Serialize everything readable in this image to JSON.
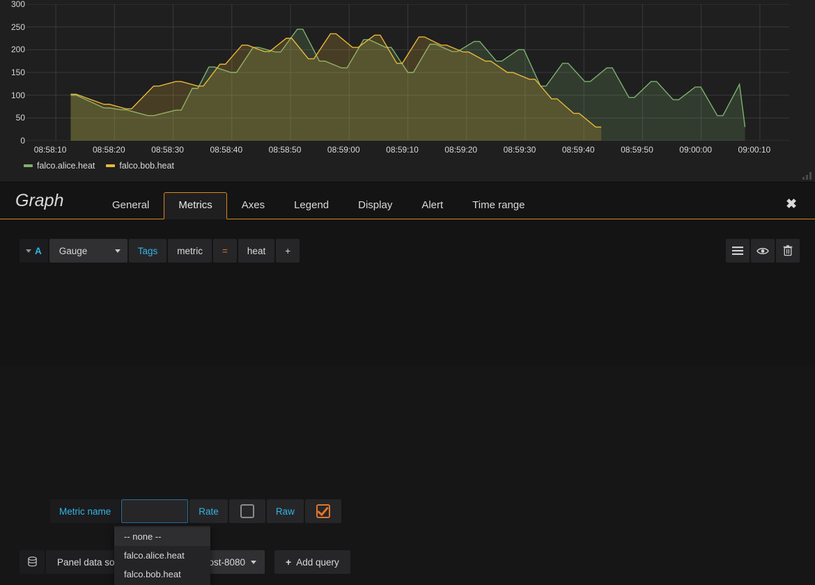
{
  "graph": {
    "legend": [
      {
        "label": "falco.alice.heat",
        "color": "#7eb26d"
      },
      {
        "label": "falco.bob.heat",
        "color": "#eab839"
      }
    ]
  },
  "chart_data": {
    "type": "line",
    "title": "",
    "xlabel": "",
    "ylabel": "",
    "ylim": [
      0,
      300
    ],
    "y_ticks": [
      0,
      50,
      100,
      150,
      200,
      250,
      300
    ],
    "x_ticks": [
      "08:58:10",
      "08:58:20",
      "08:58:30",
      "08:58:40",
      "08:58:50",
      "08:59:00",
      "08:59:10",
      "08:59:20",
      "08:59:30",
      "08:59:40",
      "08:59:50",
      "09:00:00",
      "09:00:10"
    ],
    "x_range": [
      "08:58:05",
      "09:00:15"
    ],
    "grid": true,
    "legend_position": "bottom-left",
    "fill": true,
    "series": [
      {
        "name": "falco.alice.heat",
        "color": "#7eb26d",
        "x": [
          8,
          9,
          14,
          15,
          17,
          18,
          22,
          23,
          27,
          28,
          30,
          31,
          33,
          34,
          37,
          38,
          41,
          42,
          45,
          46,
          49,
          50,
          53,
          54,
          57,
          58,
          61,
          62,
          65,
          66,
          69,
          70,
          73,
          74,
          77,
          78,
          81,
          82,
          85,
          86,
          89,
          90,
          93,
          94,
          97,
          98,
          101,
          102,
          105,
          106,
          109,
          110,
          113,
          114,
          117,
          118,
          121,
          122,
          125,
          126,
          129,
          130
        ],
        "y": [
          100,
          100,
          72,
          72,
          68,
          68,
          55,
          55,
          67,
          67,
          115,
          115,
          162,
          162,
          150,
          150,
          205,
          205,
          195,
          195,
          245,
          245,
          175,
          175,
          160,
          160,
          222,
          222,
          205,
          205,
          150,
          150,
          212,
          212,
          196,
          196,
          218,
          218,
          175,
          175,
          200,
          200,
          120,
          120,
          170,
          170,
          130,
          130,
          160,
          160,
          95,
          95,
          130,
          130,
          90,
          90,
          118,
          118,
          55,
          55,
          124,
          30
        ]
      },
      {
        "name": "falco.bob.heat",
        "color": "#eab839",
        "x": [
          8,
          9,
          14,
          15,
          18,
          19,
          23,
          24,
          27,
          28,
          31,
          32,
          35,
          36,
          39,
          40,
          43,
          44,
          47,
          48,
          51,
          52,
          55,
          56,
          59,
          60,
          63,
          64,
          67,
          68,
          71,
          72,
          75,
          76,
          79,
          80,
          83,
          84,
          87,
          88,
          91,
          92,
          95,
          96,
          99,
          100,
          103,
          104
        ],
        "y": [
          102,
          102,
          80,
          80,
          70,
          70,
          120,
          120,
          130,
          130,
          120,
          120,
          168,
          168,
          210,
          210,
          196,
          196,
          225,
          225,
          180,
          180,
          235,
          235,
          205,
          205,
          232,
          232,
          170,
          170,
          228,
          228,
          210,
          210,
          195,
          195,
          175,
          175,
          150,
          150,
          135,
          135,
          92,
          92,
          60,
          60,
          30,
          30
        ]
      }
    ]
  },
  "editor": {
    "title": "Graph",
    "tabs": [
      {
        "label": "General",
        "active": false
      },
      {
        "label": "Metrics",
        "active": true
      },
      {
        "label": "Axes",
        "active": false
      },
      {
        "label": "Legend",
        "active": false
      },
      {
        "label": "Display",
        "active": false
      },
      {
        "label": "Alert",
        "active": false
      },
      {
        "label": "Time range",
        "active": false
      }
    ],
    "close_icon": "✖",
    "query": {
      "ref_id": "A",
      "aggregator": "Gauge",
      "tags_label": "Tags",
      "tag_key": "metric",
      "tag_operator": "=",
      "tag_value": "heat",
      "add_tag_label": "+",
      "metric_name_label": "Metric name",
      "metric_name_value": "",
      "metric_name_placeholder": "",
      "rate_label": "Rate",
      "rate_checked": false,
      "raw_label": "Raw",
      "raw_checked": true,
      "actions": [
        "menu-icon",
        "eye-icon",
        "trash-icon"
      ]
    },
    "metric_dropdown": {
      "visible": true,
      "options": [
        "-- none --",
        "falco.alice.heat",
        "falco.bob.heat"
      ],
      "highlighted_index": 0
    },
    "datasource": {
      "icon": "database-icon",
      "label": "Panel data source",
      "value": "host-8080",
      "add_query_label": "Add query",
      "add_query_icon": "+"
    }
  }
}
